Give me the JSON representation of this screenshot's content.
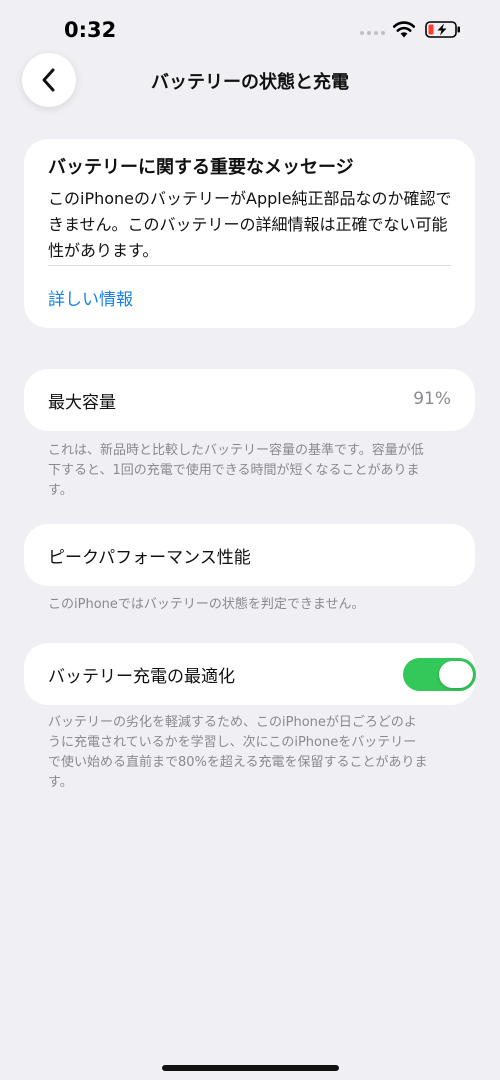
{
  "status_bar": {
    "time": "0:32",
    "icons": [
      "signal-dots-icon",
      "wifi-icon",
      "battery-charging-icon"
    ]
  },
  "nav": {
    "back_icon": "chevron-left-icon",
    "title": "バッテリーの状態と充電"
  },
  "message_card": {
    "title": "バッテリーに関する重要なメッセージ",
    "body": "このiPhoneのバッテリーがApple純正部品なのか確認できません。このバッテリーの詳細情報は正確でない可能性があります。",
    "link": "詳しい情報"
  },
  "max_capacity": {
    "label": "最大容量",
    "value": "91%",
    "footnote": "これは、新品時と比較したバッテリー容量の基準です。容量が低下すると、1回の充電で使用できる時間が短くなることがあります。"
  },
  "peak_performance": {
    "label": "ピークパフォーマンス性能",
    "footnote": "このiPhoneではバッテリーの状態を判定できません。"
  },
  "optimized_charging": {
    "label": "バッテリー充電の最適化",
    "enabled": true,
    "footnote": "バッテリーの劣化を軽減するため、このiPhoneが日ごろどのように充電されているかを学習し、次にこのiPhoneをバッテリーで使い始める直前まで80%を超える充電を保留することがあります。"
  },
  "colors": {
    "background": "#efeff4",
    "accent": "#1a82e8",
    "toggle_on": "#34c759",
    "battery_low": "#ff3b30"
  }
}
